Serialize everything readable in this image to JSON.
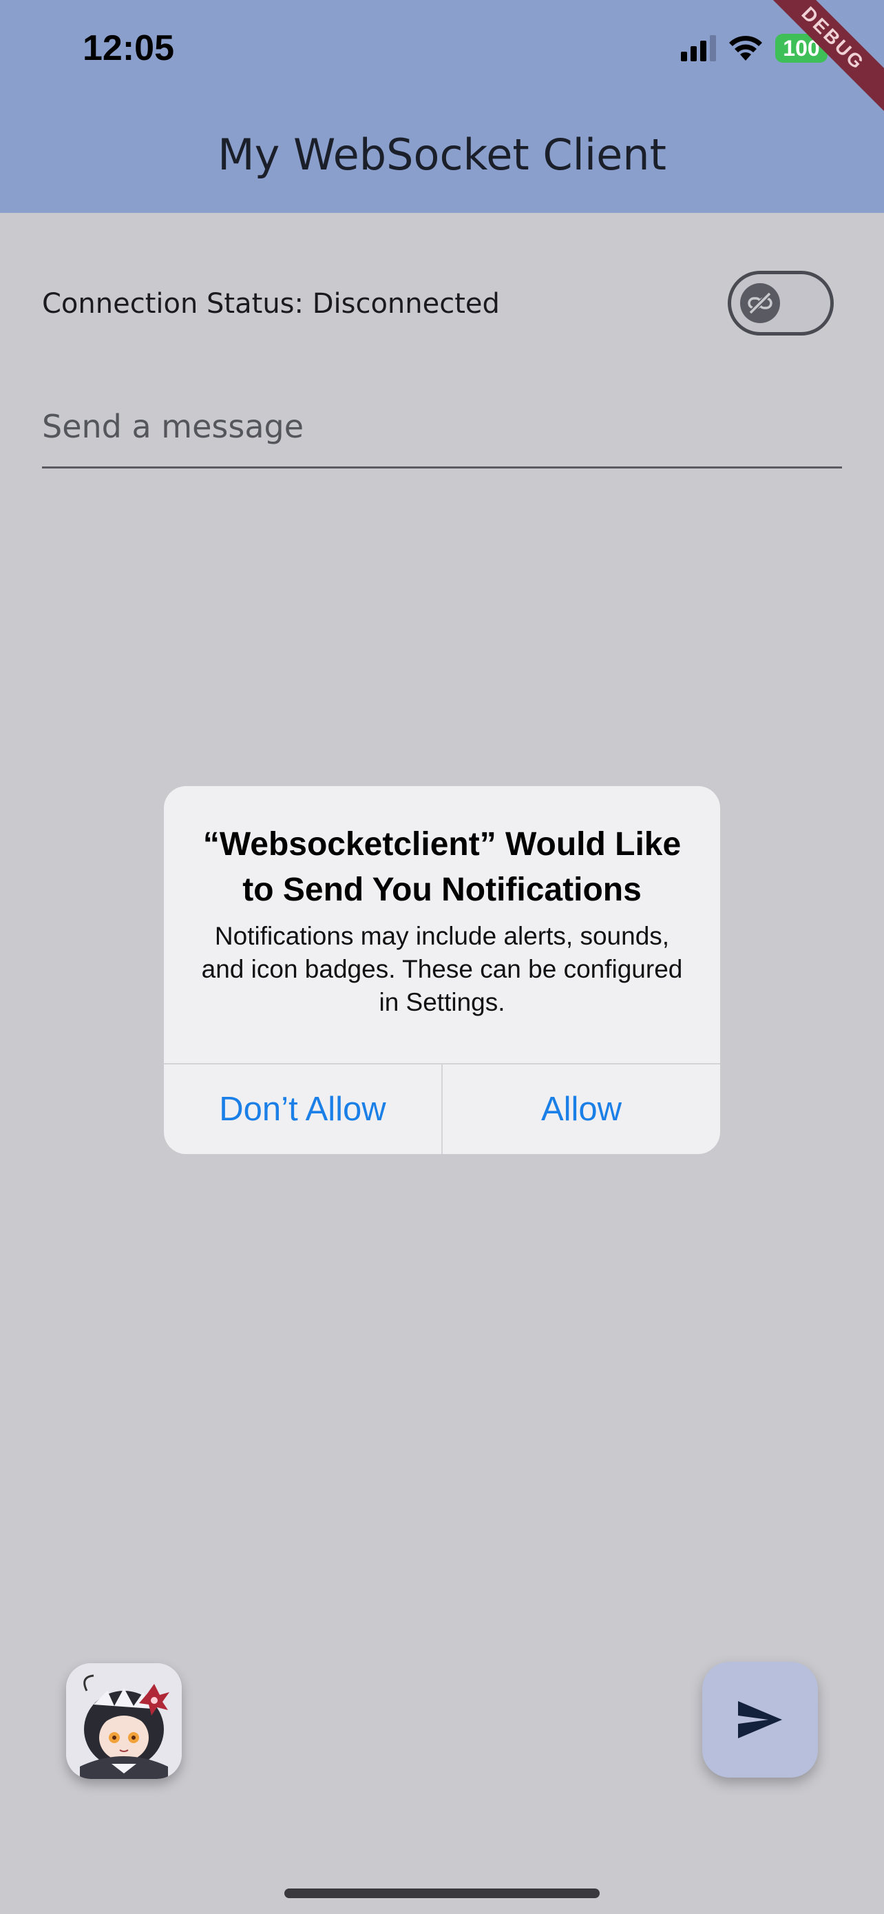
{
  "status_bar": {
    "time": "12:05",
    "battery": "100",
    "battery_color": "#3fbf58"
  },
  "debug_banner": "DEBUG",
  "app_bar": {
    "title": "My WebSocket Client",
    "color": "#8a9fcc"
  },
  "connection": {
    "label": "Connection Status: Disconnected",
    "toggle_on": false,
    "toggle_icon": "link-off-icon"
  },
  "message_input": {
    "placeholder": "Send a message",
    "value": ""
  },
  "alert": {
    "title": "“Websocketclient” Would Like to Send You Notifications",
    "message": "Notifications may include alerts, sounds, and icon badges. These can be configured in Settings.",
    "buttons": [
      "Don’t Allow",
      "Allow"
    ],
    "button_color": "#1a7fe6"
  },
  "avatar_icon": "anime-avatar-icon",
  "fab_icon": "send-icon"
}
